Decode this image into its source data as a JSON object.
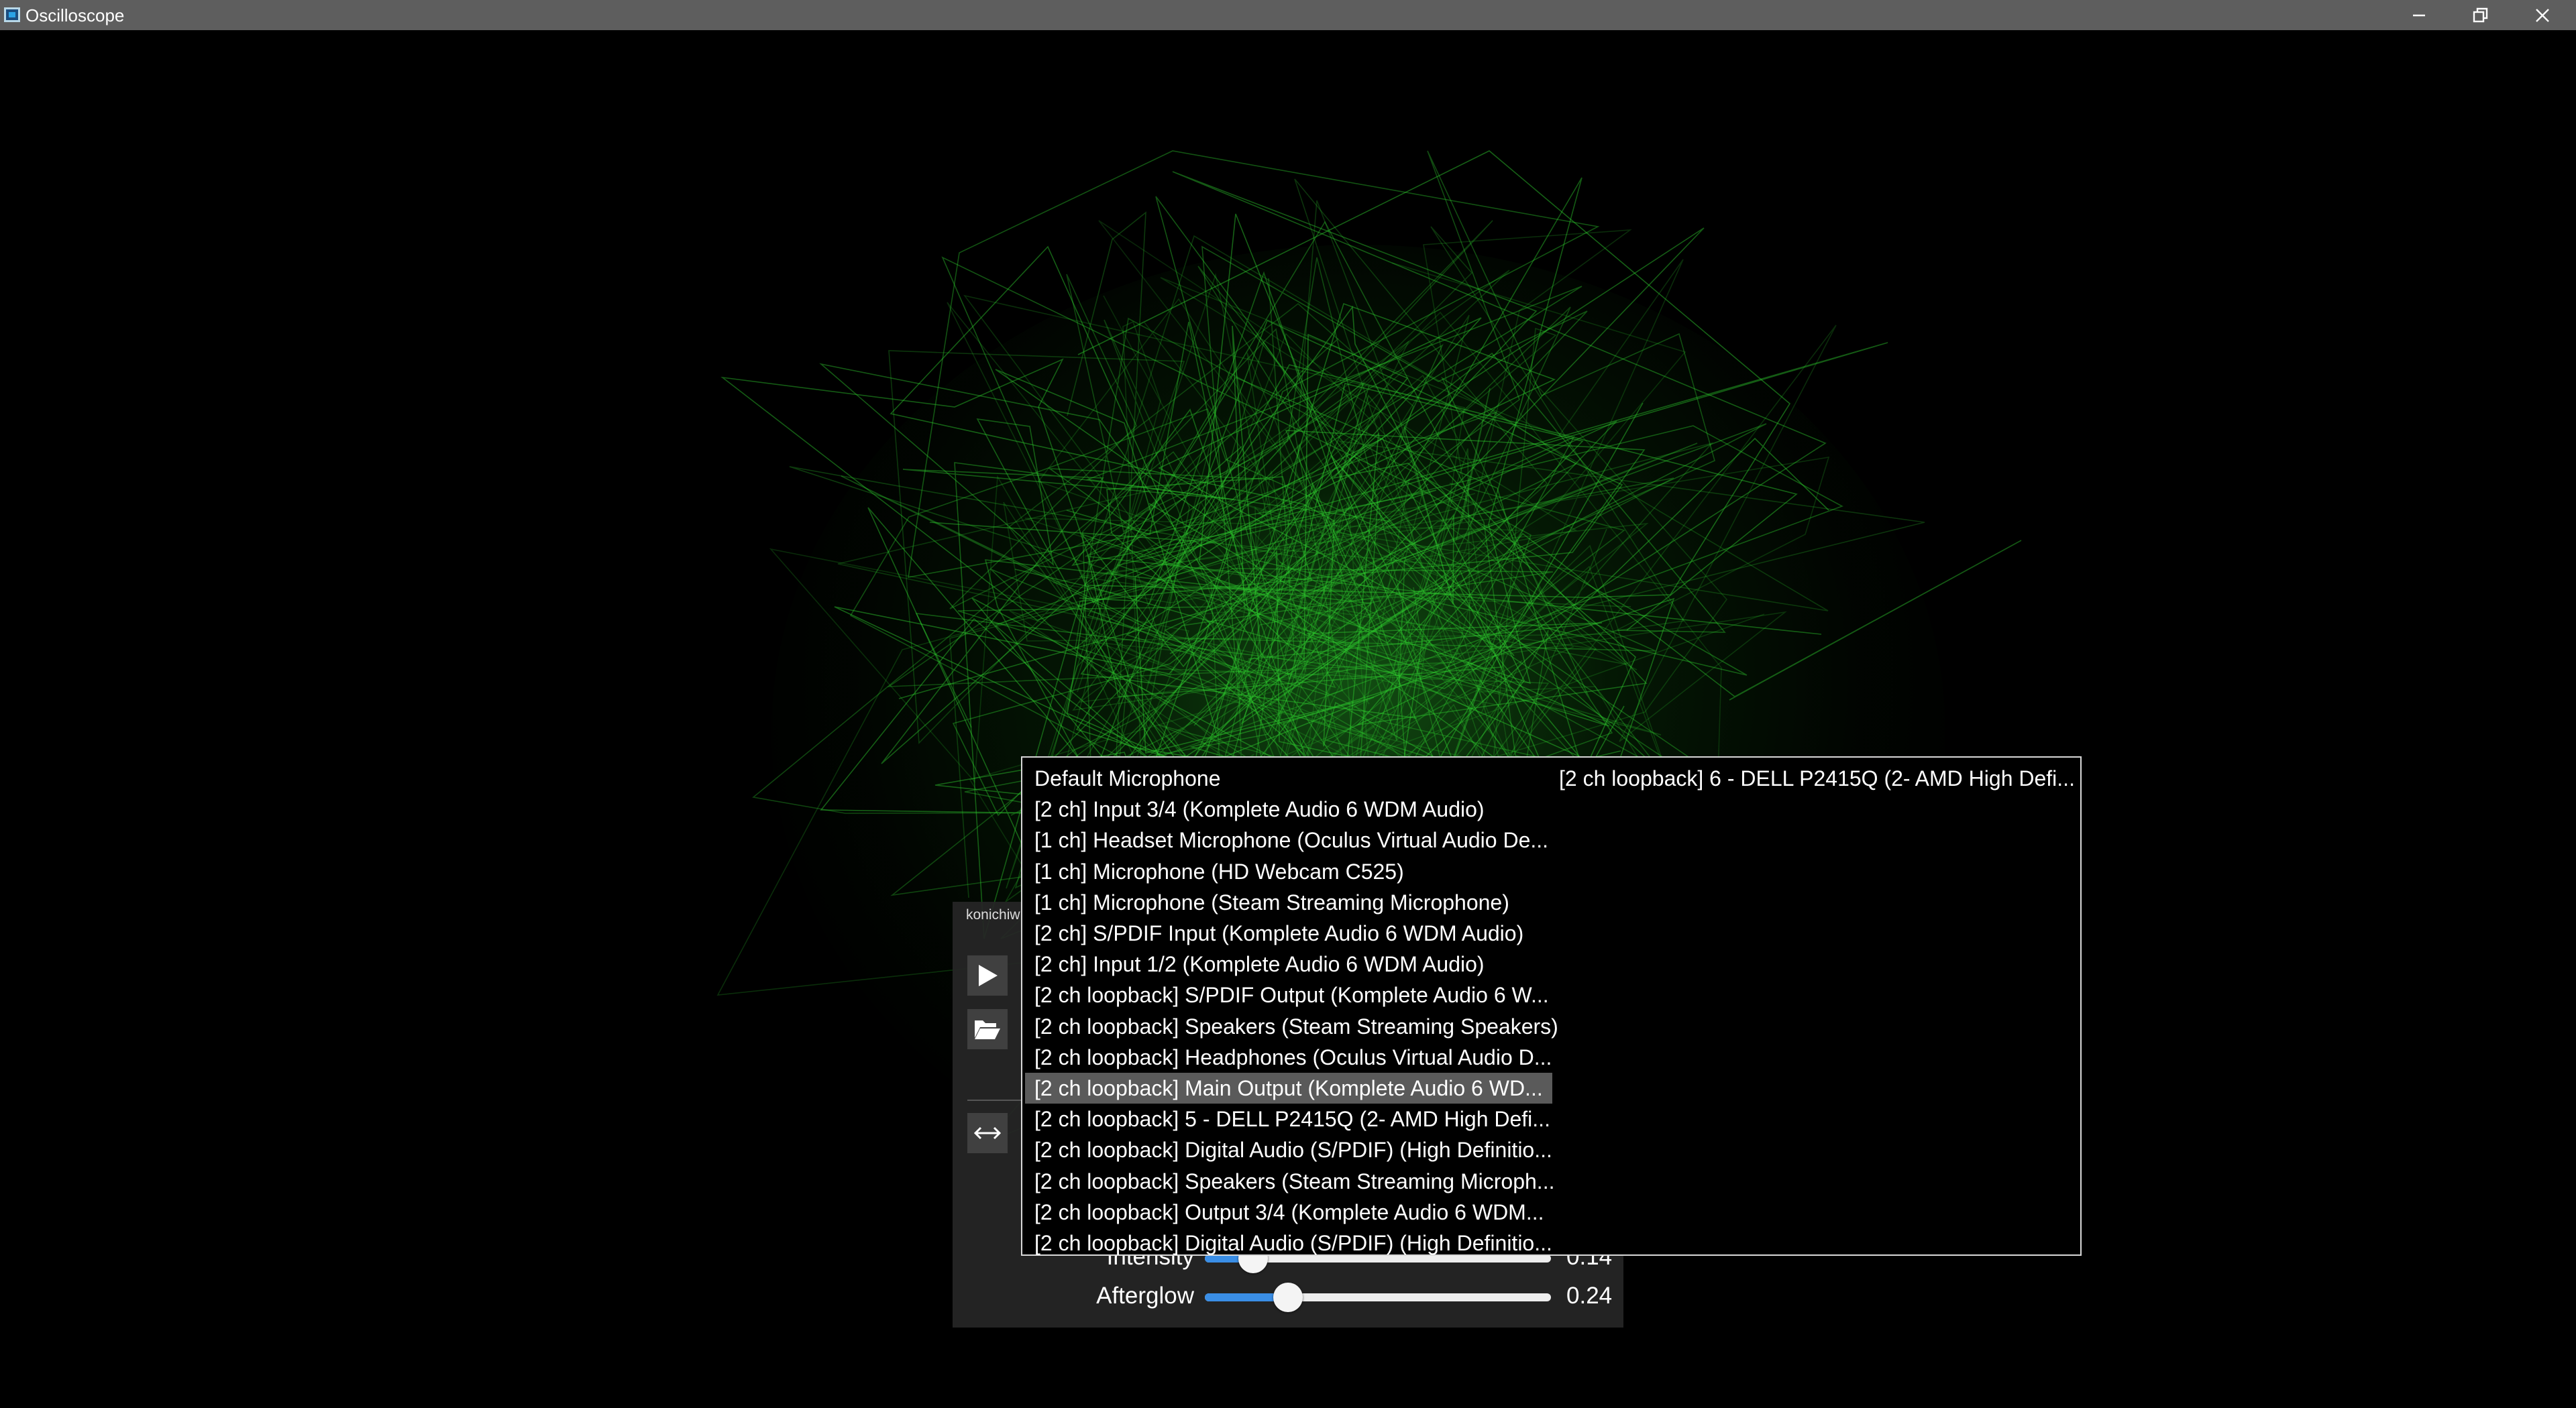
{
  "window": {
    "title": "Oscilloscope",
    "colors": {
      "titlebar": "#5e5e5e",
      "trace": "#2ecc2e",
      "accent": "#3a8ee6"
    }
  },
  "panel": {
    "caption": "konichiw",
    "play_icon": "play-icon",
    "folder_icon": "folder-open-icon",
    "stretch_icon": "horizontal-arrows-icon",
    "intensity": {
      "label": "Intensity",
      "value_text": "0.14",
      "value": 0.14
    },
    "afterglow": {
      "label": "Afterglow",
      "value_text": "0.24",
      "value": 0.24
    }
  },
  "device_dropdown": {
    "selected_index": 11,
    "items": [
      "Default Microphone",
      "[2 ch] Input 3/4 (Komplete Audio 6 WDM Audio)",
      "[1 ch] Headset Microphone (Oculus Virtual Audio De...",
      "[1 ch] Microphone (HD Webcam C525)",
      "[1 ch] Microphone (Steam Streaming Microphone)",
      "[2 ch] S/PDIF Input (Komplete Audio 6 WDM Audio)",
      "[2 ch] Input 1/2 (Komplete Audio 6 WDM Audio)",
      "[2 ch loopback] S/PDIF Output (Komplete Audio 6 W...",
      "[2 ch loopback] Speakers (Steam Streaming Speakers)",
      "[2 ch loopback] Headphones (Oculus Virtual Audio D...",
      "[2 ch loopback] Main Output (Komplete Audio 6 WD...",
      "[2 ch loopback] 5 - DELL P2415Q (2- AMD High Defi...",
      "[2 ch loopback] Digital Audio (S/PDIF) (High Definitio...",
      "[2 ch loopback] Speakers (Steam Streaming Microph...",
      "[2 ch loopback] Output 3/4 (Komplete Audio 6 WDM...",
      "[2 ch loopback] Digital Audio (S/PDIF) (High Definitio...",
      "[2 ch loopback] 6 - DELL P2415Q (2- AMD High Defi..."
    ]
  }
}
